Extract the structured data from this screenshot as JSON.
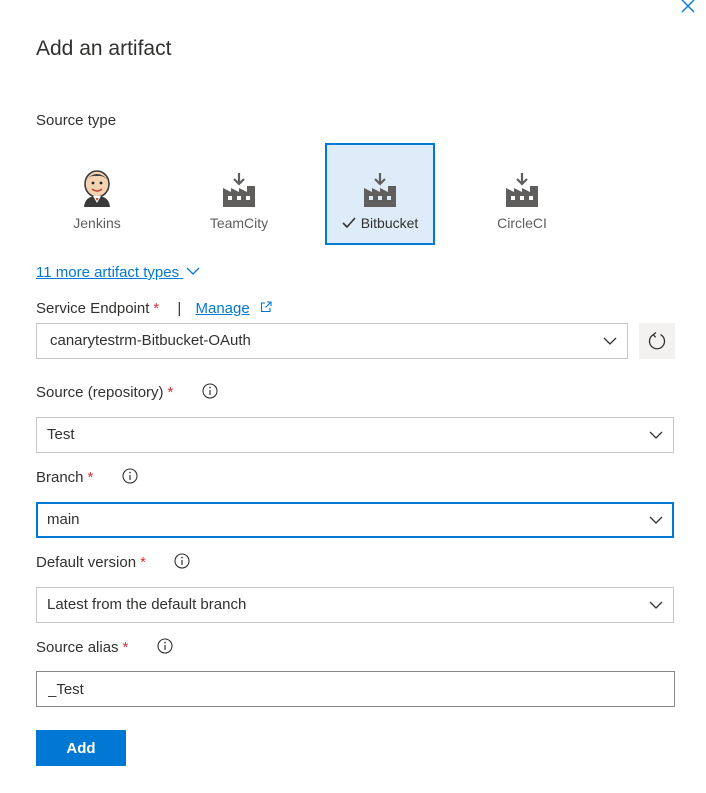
{
  "panel": {
    "title": "Add an artifact"
  },
  "source_type": {
    "label": "Source type",
    "items": [
      {
        "label": "Jenkins",
        "icon": "jenkins-icon",
        "selected": false
      },
      {
        "label": "TeamCity",
        "icon": "build-factory-icon",
        "selected": false
      },
      {
        "label": "Bitbucket",
        "icon": "build-factory-icon",
        "selected": true
      },
      {
        "label": "CircleCI",
        "icon": "build-factory-icon",
        "selected": false
      }
    ],
    "more_link": "11 more artifact types"
  },
  "service_endpoint": {
    "label": "Service Endpoint",
    "required_mark": "*",
    "separator": "|",
    "manage_label": "Manage",
    "value": "canarytestrm-Bitbucket-OAuth"
  },
  "source_repository": {
    "label": "Source (repository)",
    "required_mark": "*",
    "value": "Test"
  },
  "branch": {
    "label": "Branch",
    "required_mark": "*",
    "value": "main"
  },
  "default_version": {
    "label": "Default version",
    "required_mark": "*",
    "value": "Latest from the default branch"
  },
  "source_alias": {
    "label": "Source alias",
    "required_mark": "*",
    "value": "_Test"
  },
  "actions": {
    "add_label": "Add"
  },
  "colors": {
    "accent": "#0078d4",
    "required": "#d13438",
    "selected_bg": "#deecf9"
  }
}
